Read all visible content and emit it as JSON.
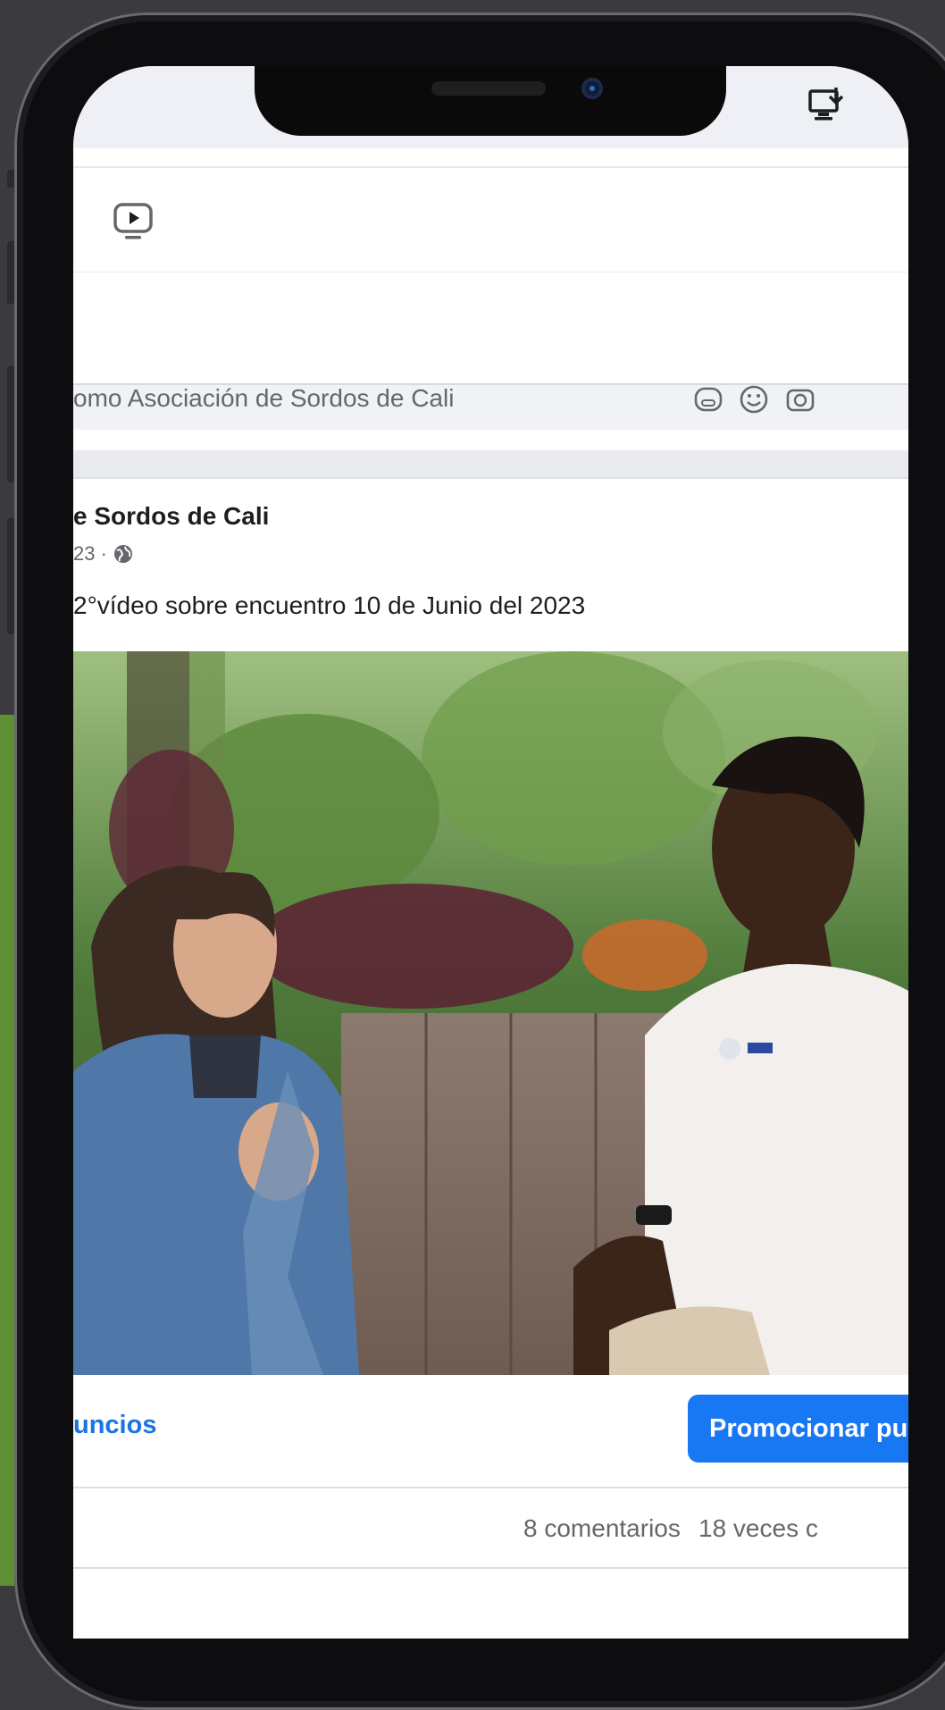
{
  "composer": {
    "placeholder_fragment": "omo Asociación de Sordos de Cali"
  },
  "post": {
    "author_fragment": "e Sordos de Cali",
    "date_fragment": "23 ·",
    "caption": "2°vídeo sobre encuentro 10 de Junio del 2023"
  },
  "actions": {
    "ads_link_fragment": "uncios",
    "promote_button_fragment": "Promocionar pu"
  },
  "stats": {
    "comments": "8 comentarios",
    "shares_fragment": "18 veces c"
  },
  "icons": {
    "status_right": "download-to-computer-icon",
    "nav": "watch-video-icon",
    "composer": [
      "gif-icon",
      "emoji-icon",
      "camera-icon"
    ],
    "audience": "globe-icon"
  },
  "colors": {
    "accent": "#1877f2",
    "link": "#1b74e4",
    "background_left": "#5e8f33"
  }
}
